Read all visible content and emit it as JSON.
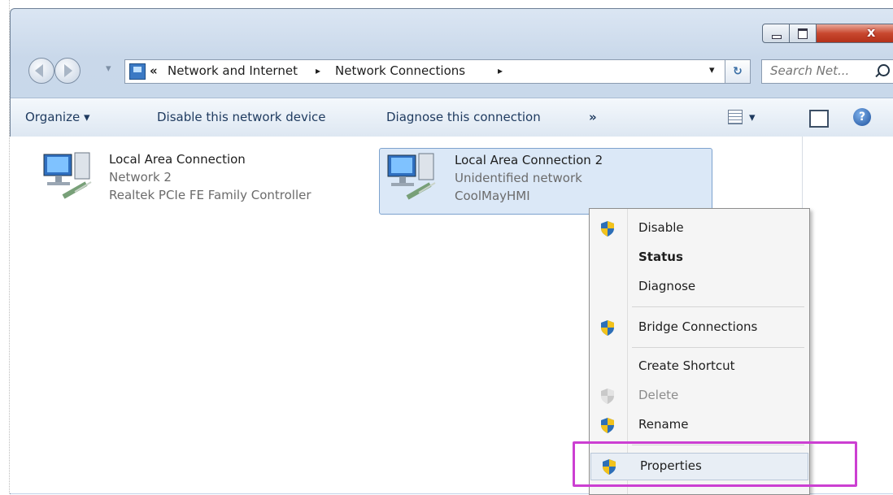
{
  "window": {
    "controls": {
      "minimize_icon": "minimize-icon",
      "maximize_icon": "maximize-icon",
      "close_icon": "close-icon",
      "close_glyph": "x"
    }
  },
  "nav": {
    "back_icon": "back-arrow-icon",
    "forward_icon": "forward-arrow-icon",
    "breadcrumb": {
      "overflow": "«",
      "items": [
        "Network and Internet",
        "Network Connections"
      ],
      "separator": "▸"
    },
    "dropdown_glyph": "▾",
    "refresh_glyph": "↻",
    "search_placeholder": "Search Net..."
  },
  "commandbar": {
    "organize": "Organize ▾",
    "disable": "Disable this network device",
    "diagnose": "Diagnose this connection",
    "more": "»",
    "view_dropdown": "▾",
    "help_glyph": "?"
  },
  "connections": [
    {
      "name": "Local Area Connection",
      "network": "Network  2",
      "device": "Realtek PCIe FE Family Controller"
    },
    {
      "name": "Local Area Connection 2",
      "network": "Unidentified network",
      "device": "CoolMayHMI"
    }
  ],
  "context_menu": {
    "items": [
      {
        "label": "Disable",
        "shield": true,
        "enabled": true,
        "bold": false
      },
      {
        "label": "Status",
        "shield": false,
        "enabled": true,
        "bold": true
      },
      {
        "label": "Diagnose",
        "shield": false,
        "enabled": true,
        "bold": false
      },
      {
        "label": "Bridge Connections",
        "shield": true,
        "enabled": true,
        "bold": false
      },
      {
        "label": "Create Shortcut",
        "shield": false,
        "enabled": true,
        "bold": false
      },
      {
        "label": "Delete",
        "shield": true,
        "enabled": false,
        "bold": false
      },
      {
        "label": "Rename",
        "shield": true,
        "enabled": true,
        "bold": false
      },
      {
        "label": "Properties",
        "shield": true,
        "enabled": true,
        "bold": false
      }
    ],
    "highlight_color": "#cc3fd2"
  }
}
